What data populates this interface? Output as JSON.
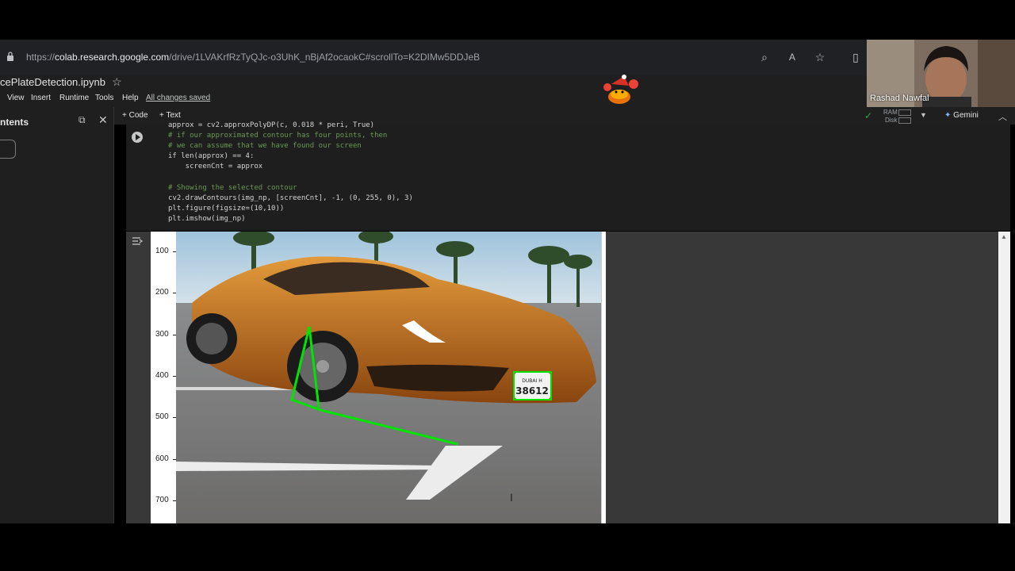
{
  "browser": {
    "url_prefix": "https://",
    "url_domain": "colab.research.google.com",
    "url_path": "/drive/1LVAKrfRzTyQJc-o3UhK_nBjAf2ocaokC#scrollTo=K2DIMw5DDJeB"
  },
  "notebook": {
    "title": "cePlateDetection.ipynb",
    "menu": [
      "View",
      "Insert",
      "Runtime",
      "Tools",
      "Help"
    ],
    "saved_status": "All changes saved"
  },
  "webcam": {
    "name": "Rashad Nawfal"
  },
  "sidebar": {
    "title": "ntents"
  },
  "toolbar": {
    "add_code": "+ Code",
    "add_text": "+ Text",
    "ram": "RAM",
    "disk": "Disk",
    "gemini": "Gemini"
  },
  "code_lines": [
    {
      "text": "approx = cv2.approxPolyDP(c, 0.018 * peri, True)",
      "kind": "code"
    },
    {
      "text": "# if our approximated contour has four points, then",
      "kind": "comment"
    },
    {
      "text": "# we can assume that we have found our screen",
      "kind": "comment"
    },
    {
      "text": "if len(approx) == 4:",
      "kind": "code"
    },
    {
      "text": "    screenCnt = approx",
      "kind": "code"
    },
    {
      "text": "",
      "kind": "code"
    },
    {
      "text": "# Showing the selected contour",
      "kind": "comment"
    },
    {
      "text": "cv2.drawContours(img_np, [screenCnt], -1, (0, 255, 0), 3)",
      "kind": "code"
    },
    {
      "text": "plt.figure(figsize=(10,10))",
      "kind": "code"
    },
    {
      "text": "plt.imshow(img_np)",
      "kind": "code"
    }
  ],
  "plot": {
    "y_ticks": [
      "100",
      "200",
      "300",
      "400",
      "500",
      "600",
      "700"
    ],
    "plate_top": "DUBAI  H",
    "plate_number": "38612"
  },
  "colors": {
    "accent": "#8ab4f8",
    "contour": "#00ff00",
    "car": "#c8731a"
  }
}
